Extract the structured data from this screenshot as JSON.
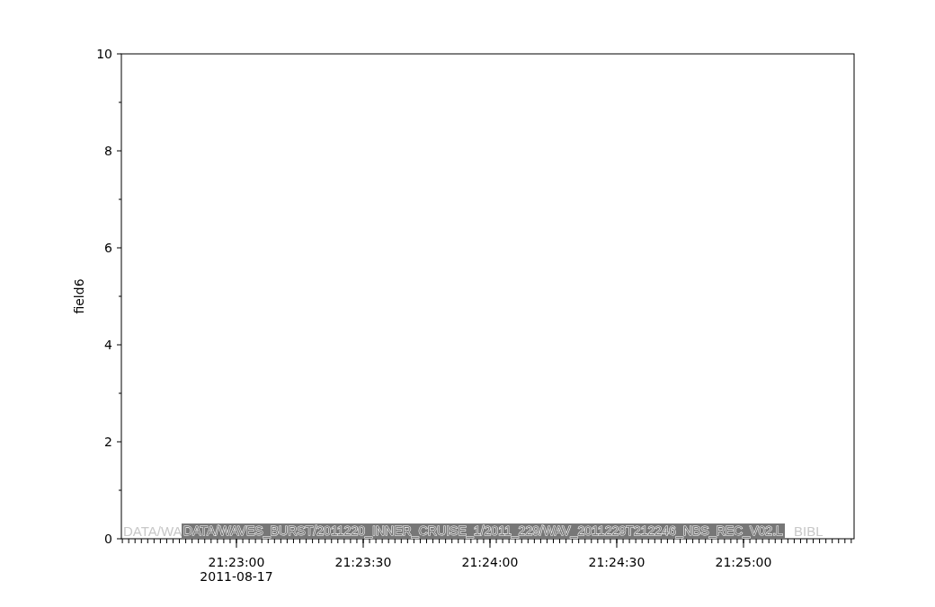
{
  "plot": {
    "chart_data": {
      "type": "line",
      "ylabel": "field6",
      "ylim": [
        0,
        10
      ],
      "yticks": [
        0,
        2,
        4,
        6,
        8,
        10
      ],
      "categories": [
        "21:23:00",
        "21:23:30",
        "21:24:00",
        "21:24:30",
        "21:25:00"
      ],
      "values": [
        null,
        null,
        null,
        null,
        null
      ]
    },
    "date_label": "2011-08-17",
    "back_label_start": "DATA/WA",
    "back_label_end": "BIBL",
    "file_label": "DATA/WAVES_BURST/2011220_INNER_CRUISE_1/2011_229/WAV_2011229T212246_NBS_REC_V02.L"
  }
}
